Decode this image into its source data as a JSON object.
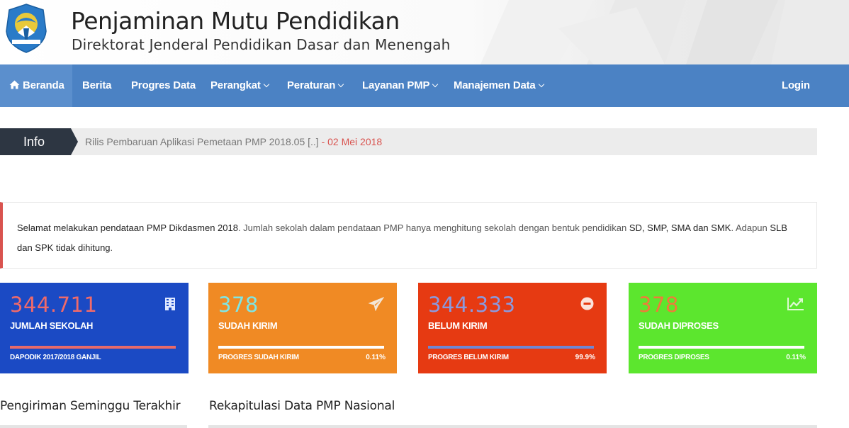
{
  "header": {
    "title": "Penjaminan Mutu Pendidikan",
    "subtitle": "Direktorat Jenderal Pendidikan Dasar dan Menengah"
  },
  "navbar": {
    "items": [
      {
        "label": "Beranda",
        "icon": "home-icon"
      },
      {
        "label": "Berita"
      },
      {
        "label": "Progres Data"
      },
      {
        "label": "Perangkat",
        "dropdown": true
      },
      {
        "label": "Peraturan",
        "dropdown": true
      },
      {
        "label": "Layanan PMP",
        "dropdown": true
      },
      {
        "label": "Manajemen Data",
        "dropdown": true
      }
    ],
    "login_label": "Login"
  },
  "info": {
    "label": "Info",
    "text": "Rilis Pembaruan Aplikasi Pemetaan PMP 2018.05 [..]",
    "date": " - 02 Mei 2018"
  },
  "notice": {
    "bold_1": "Selamat melakukan pendataan PMP Dikdasmen 2018",
    "text_1": ". Jumlah sekolah dalam pendataan PMP hanya menghitung sekolah dengan bentuk pendidikan ",
    "bold_2": "SD, SMP, SMA dan SMK",
    "text_2": ". Adapun ",
    "bold_3": "SLB dan SPK tidak dihitung",
    "text_3": "."
  },
  "stats": [
    {
      "value": "344.711",
      "label": "JUMLAH SEKOLAH",
      "footer": "DAPODIK 2017/2018 GANJIL",
      "percent": "",
      "progress": 1.0,
      "icon": "building-icon",
      "bg": "#1b4ac4",
      "value_color": "#f06a6a",
      "bar_color": "#e76a6a"
    },
    {
      "value": "378",
      "label": "SUDAH KIRIM",
      "footer": "PROGRES SUDAH KIRIM",
      "percent": "0.11%",
      "progress": 0.0011,
      "icon": "paper-plane-icon",
      "bg": "#f08a24",
      "value_color": "#7ee6e6",
      "bar_color": "#ffffff"
    },
    {
      "value": "344.333",
      "label": "BELUM KIRIM",
      "footer": "PROGRES BELUM KIRIM",
      "percent": "99.9%",
      "progress": 0.999,
      "icon": "minus-circle-icon",
      "bg": "#e63a12",
      "value_color": "#8a9ae0",
      "bar_color": "#6f86d4"
    },
    {
      "value": "378",
      "label": "SUDAH DIPROSES",
      "footer": "PROGRES DIPROSES",
      "percent": "0.11%",
      "progress": 0.0011,
      "icon": "line-chart-icon",
      "bg": "#5ce62e",
      "value_color": "#f07a3a",
      "bar_color": "#ffffff"
    }
  ],
  "sections": {
    "weekly": "Pengiriman Seminggu Terakhir",
    "recap": "Rekapitulasi Data PMP Nasional"
  }
}
